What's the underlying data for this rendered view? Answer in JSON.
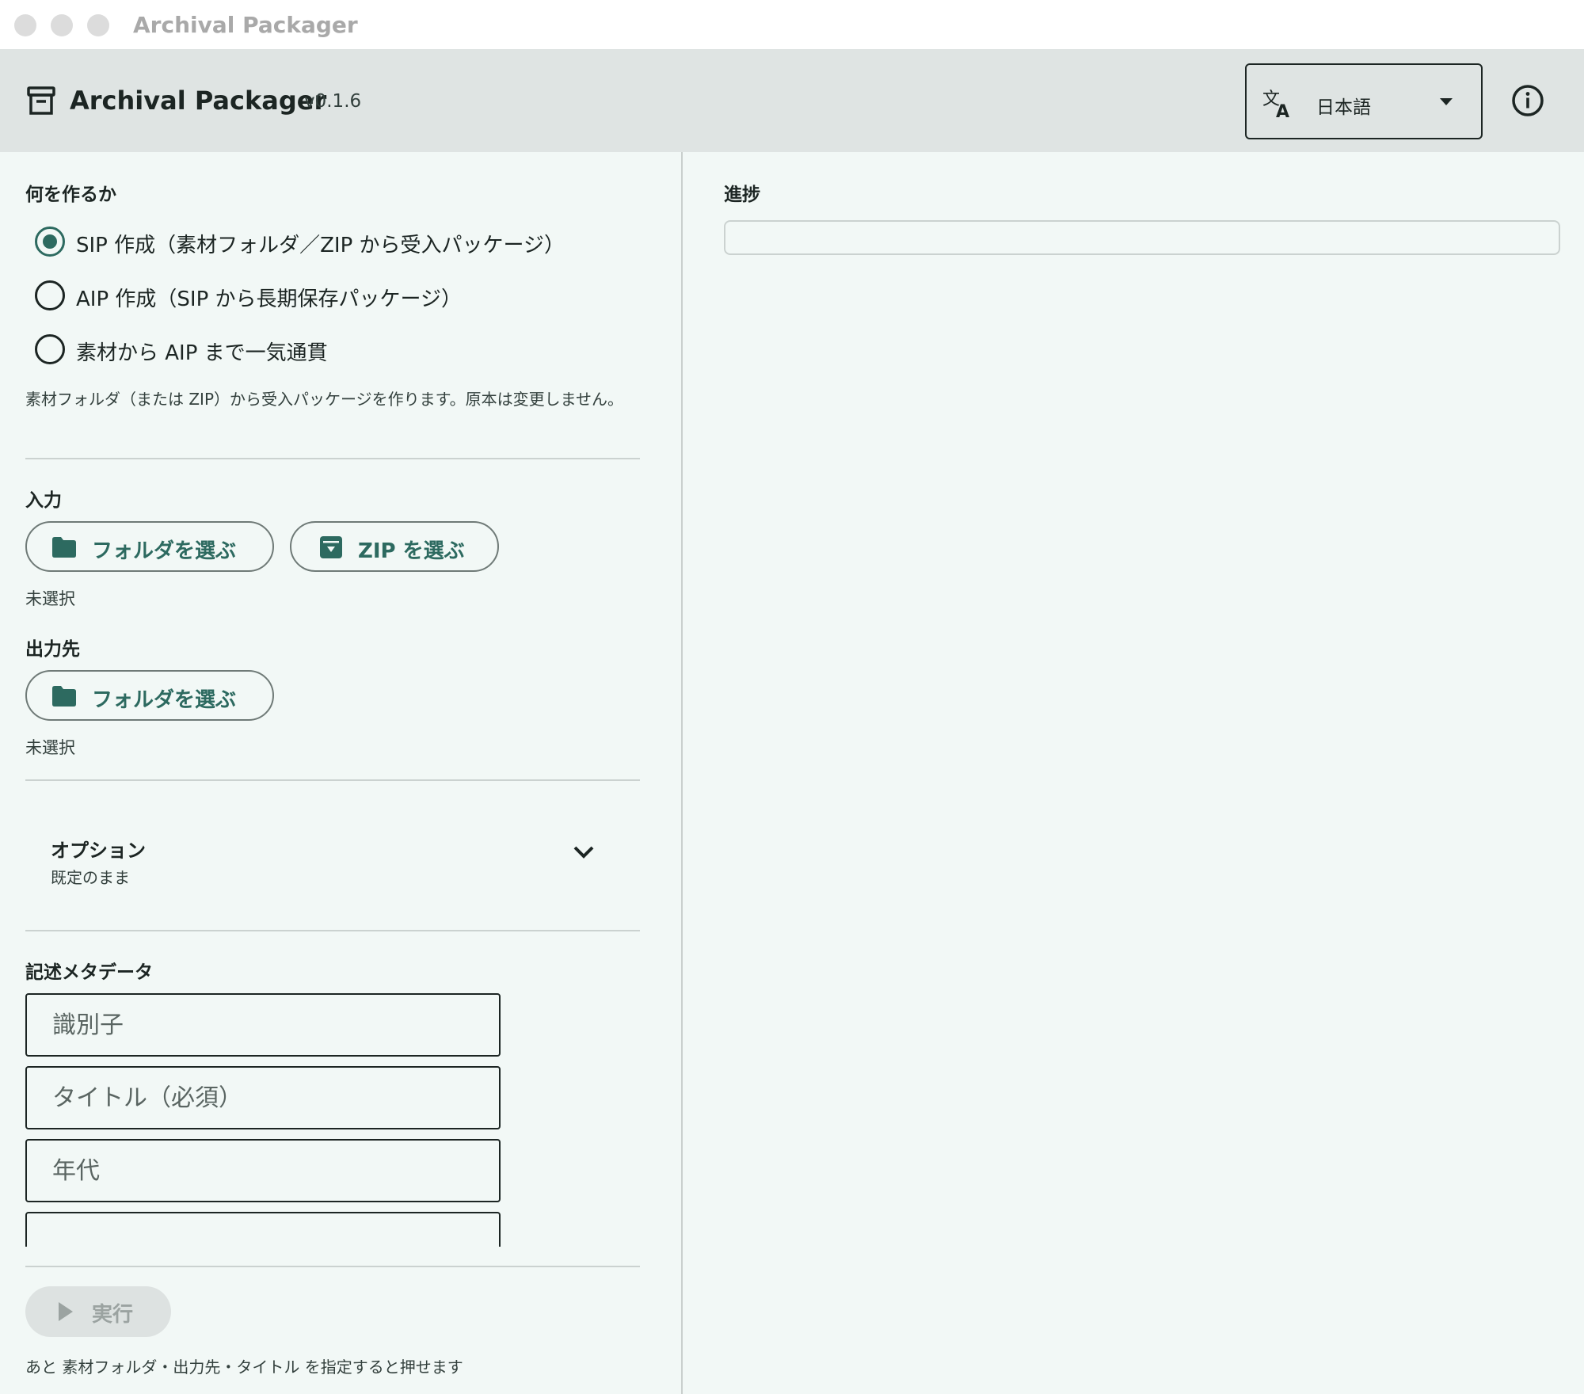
{
  "window": {
    "title": "Archival Packager"
  },
  "header": {
    "app_name": "Archival Packager",
    "version": "v0.1.6",
    "language": {
      "selected": "日本語",
      "icon": "translate-icon"
    },
    "info_icon": "info-icon"
  },
  "mode": {
    "heading": "何を作るか",
    "options": [
      {
        "label": "SIP 作成（素材フォルダ／ZIP から受入パッケージ）",
        "selected": true
      },
      {
        "label": "AIP 作成（SIP から長期保存パッケージ）",
        "selected": false
      },
      {
        "label": "素材から AIP まで一気通貫",
        "selected": false
      }
    ],
    "description": "素材フォルダ（または ZIP）から受入パッケージを作ります。原本は変更しません。"
  },
  "input": {
    "heading": "入力",
    "folder_button": "フォルダを選ぶ",
    "zip_button": "ZIP を選ぶ",
    "status": "未選択"
  },
  "output": {
    "heading": "出力先",
    "folder_button": "フォルダを選ぶ",
    "status": "未選択"
  },
  "options": {
    "title": "オプション",
    "subtitle": "既定のまま"
  },
  "metadata": {
    "heading": "記述メタデータ",
    "fields": [
      {
        "placeholder": "識別子"
      },
      {
        "placeholder": "タイトル（必須）"
      },
      {
        "placeholder": "年代"
      },
      {
        "placeholder": ""
      }
    ]
  },
  "run": {
    "label": "実行",
    "hint": "あと 素材フォルダ・出力先・タイトル を指定すると押せます"
  },
  "progress": {
    "heading": "進捗",
    "value": 0
  },
  "colors": {
    "accent": "#2d6a60",
    "header_bg": "#dfe4e3",
    "panel_bg": "#f2f8f6"
  }
}
